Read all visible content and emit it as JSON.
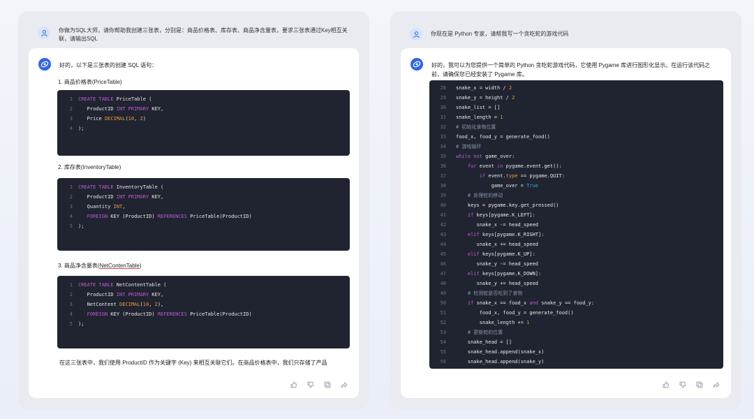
{
  "left": {
    "user_prompt": "你做为SQL大师，请你帮助我创建三张表，分别是：商品价格表、库存表、商品净含量表，要求三张表通过Key相互关联，请输出SQL",
    "bot_intro": "好的，以下是三张表的创建 SQL 语句：",
    "sections": [
      {
        "label": "1. 商品价格表(PriceTable)"
      },
      {
        "label_prefix": "2. 库存表(InventoryTable)"
      },
      {
        "label_prefix": "3. 商品净含量表(",
        "label_underlined": "NetContenTable",
        "label_suffix": ")"
      }
    ],
    "footer": "在这三张表中，我们使用 ProductID 作为关键字 (Key) 来相互关联它们。在商品价格表中，我们只存储了产品"
  },
  "right": {
    "user_prompt": "你现在是 Python 专家，请帮我写一个贪吃蛇的游戏代码",
    "bot_intro": "好的，我可以为您提供一个简单的 Python 贪吃蛇游戏代码，它使用 Pygame 库进行图形化显示。在运行该代码之前，请确保您已经安装了 Pygame 库。"
  },
  "colors": {
    "code_bg": "#1f2430",
    "keyword": "#c05ad6",
    "number": "#e89a3a",
    "comment": "#8a92a6",
    "boolean": "#3aa7f0",
    "accent": "#2f66e7"
  },
  "icons": [
    "user-icon",
    "bot-logo-icon",
    "thumbs-up-icon",
    "thumbs-down-icon",
    "copy-icon",
    "share-icon"
  ]
}
